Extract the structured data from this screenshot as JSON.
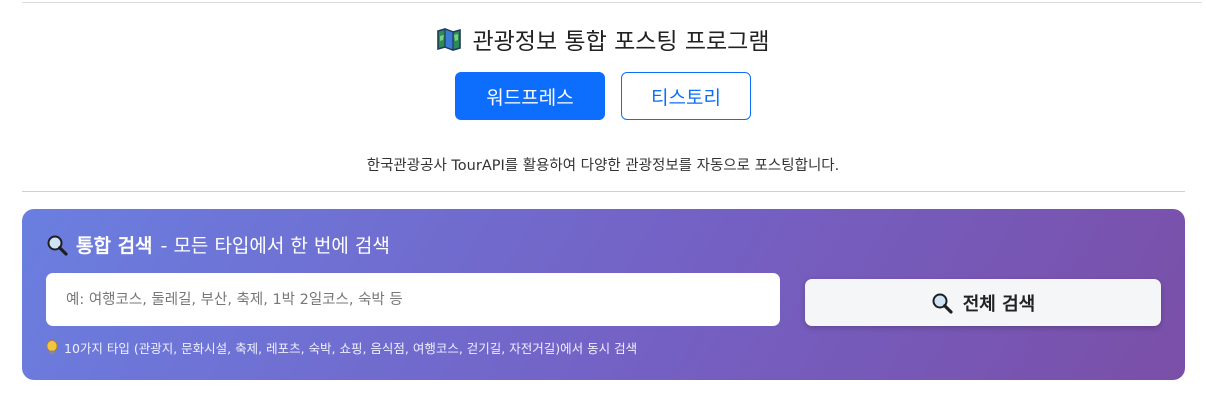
{
  "header": {
    "title": "관광정보 통합 포스팅 프로그램",
    "icon": "map-icon"
  },
  "tabs": [
    {
      "label": "워드프레스",
      "active": true
    },
    {
      "label": "티스토리",
      "active": false
    }
  ],
  "subtitle": "한국관광공사 TourAPI를 활용하여 다양한 관광정보를 자동으로 포스팅합니다.",
  "search": {
    "title_strong": "통합 검색",
    "title_rest": "- 모든 타입에서 한 번에 검색",
    "placeholder": "예: 여행코스, 둘레길, 부산, 축제, 1박 2일코스, 숙박 등",
    "value": "",
    "button_label": "전체 검색",
    "hint": "10가지 타입 (관광지, 문화시설, 축제, 레포츠, 숙박, 쇼핑, 음식점, 여행코스, 걷기길, 자전거길)에서 동시 검색"
  },
  "colors": {
    "primary": "#0d6efd",
    "panel_gradient_start": "#6a7fe0",
    "panel_gradient_end": "#7a4fa8"
  }
}
